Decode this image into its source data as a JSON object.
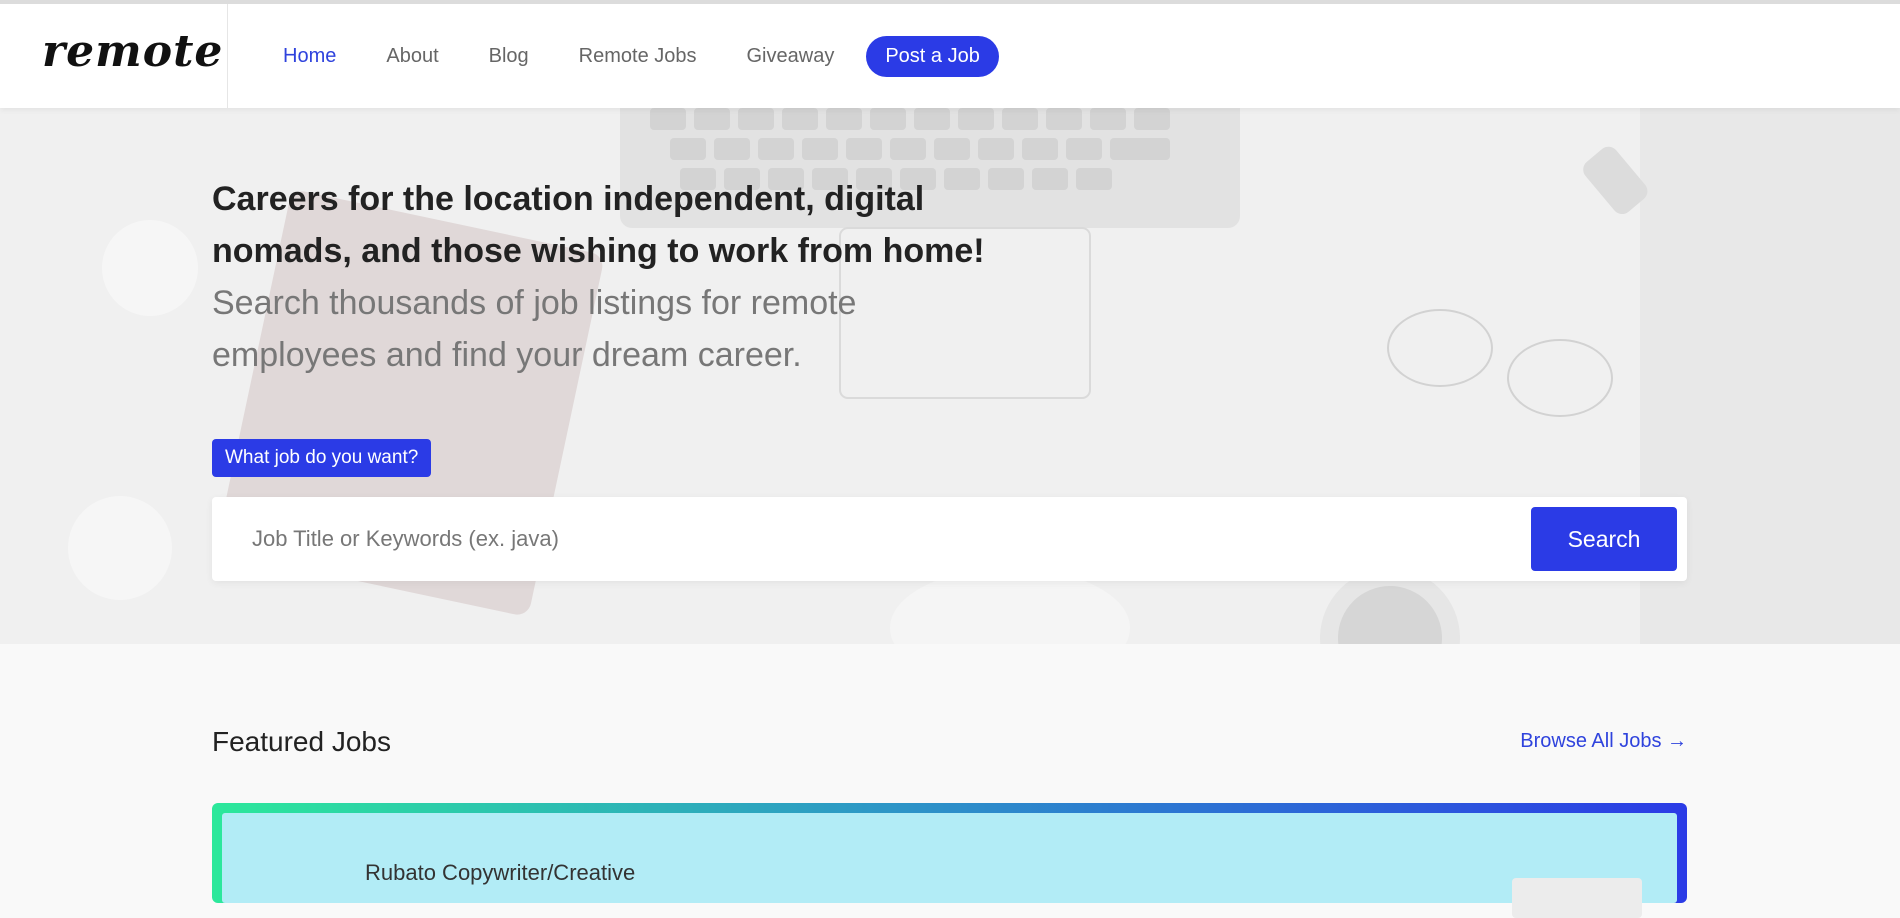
{
  "header": {
    "logo_text": "remote",
    "nav": [
      {
        "label": "Home",
        "active": true
      },
      {
        "label": "About"
      },
      {
        "label": "Blog"
      },
      {
        "label": "Remote Jobs"
      },
      {
        "label": "Giveaway"
      }
    ],
    "post_job_label": "Post a Job"
  },
  "hero": {
    "title": "Careers for the location independent, digital nomads, and those wishing to work from home!",
    "subtitle": "Search thousands of job listings for remote employees and find your dream career.",
    "tag_label": "What job do you want?",
    "search_placeholder": "Job Title or Keywords (ex. java)",
    "search_button_label": "Search"
  },
  "featured": {
    "title": "Featured Jobs",
    "browse_label": "Browse All Jobs →",
    "jobs": [
      {
        "title": "Rubato Copywriter/Creative"
      }
    ]
  },
  "colors": {
    "accent": "#2b3be6",
    "link": "#2f43dd",
    "card_bg": "#b2ecf6",
    "gradient_start": "#2ce89b",
    "gradient_end": "#2b3be6"
  }
}
